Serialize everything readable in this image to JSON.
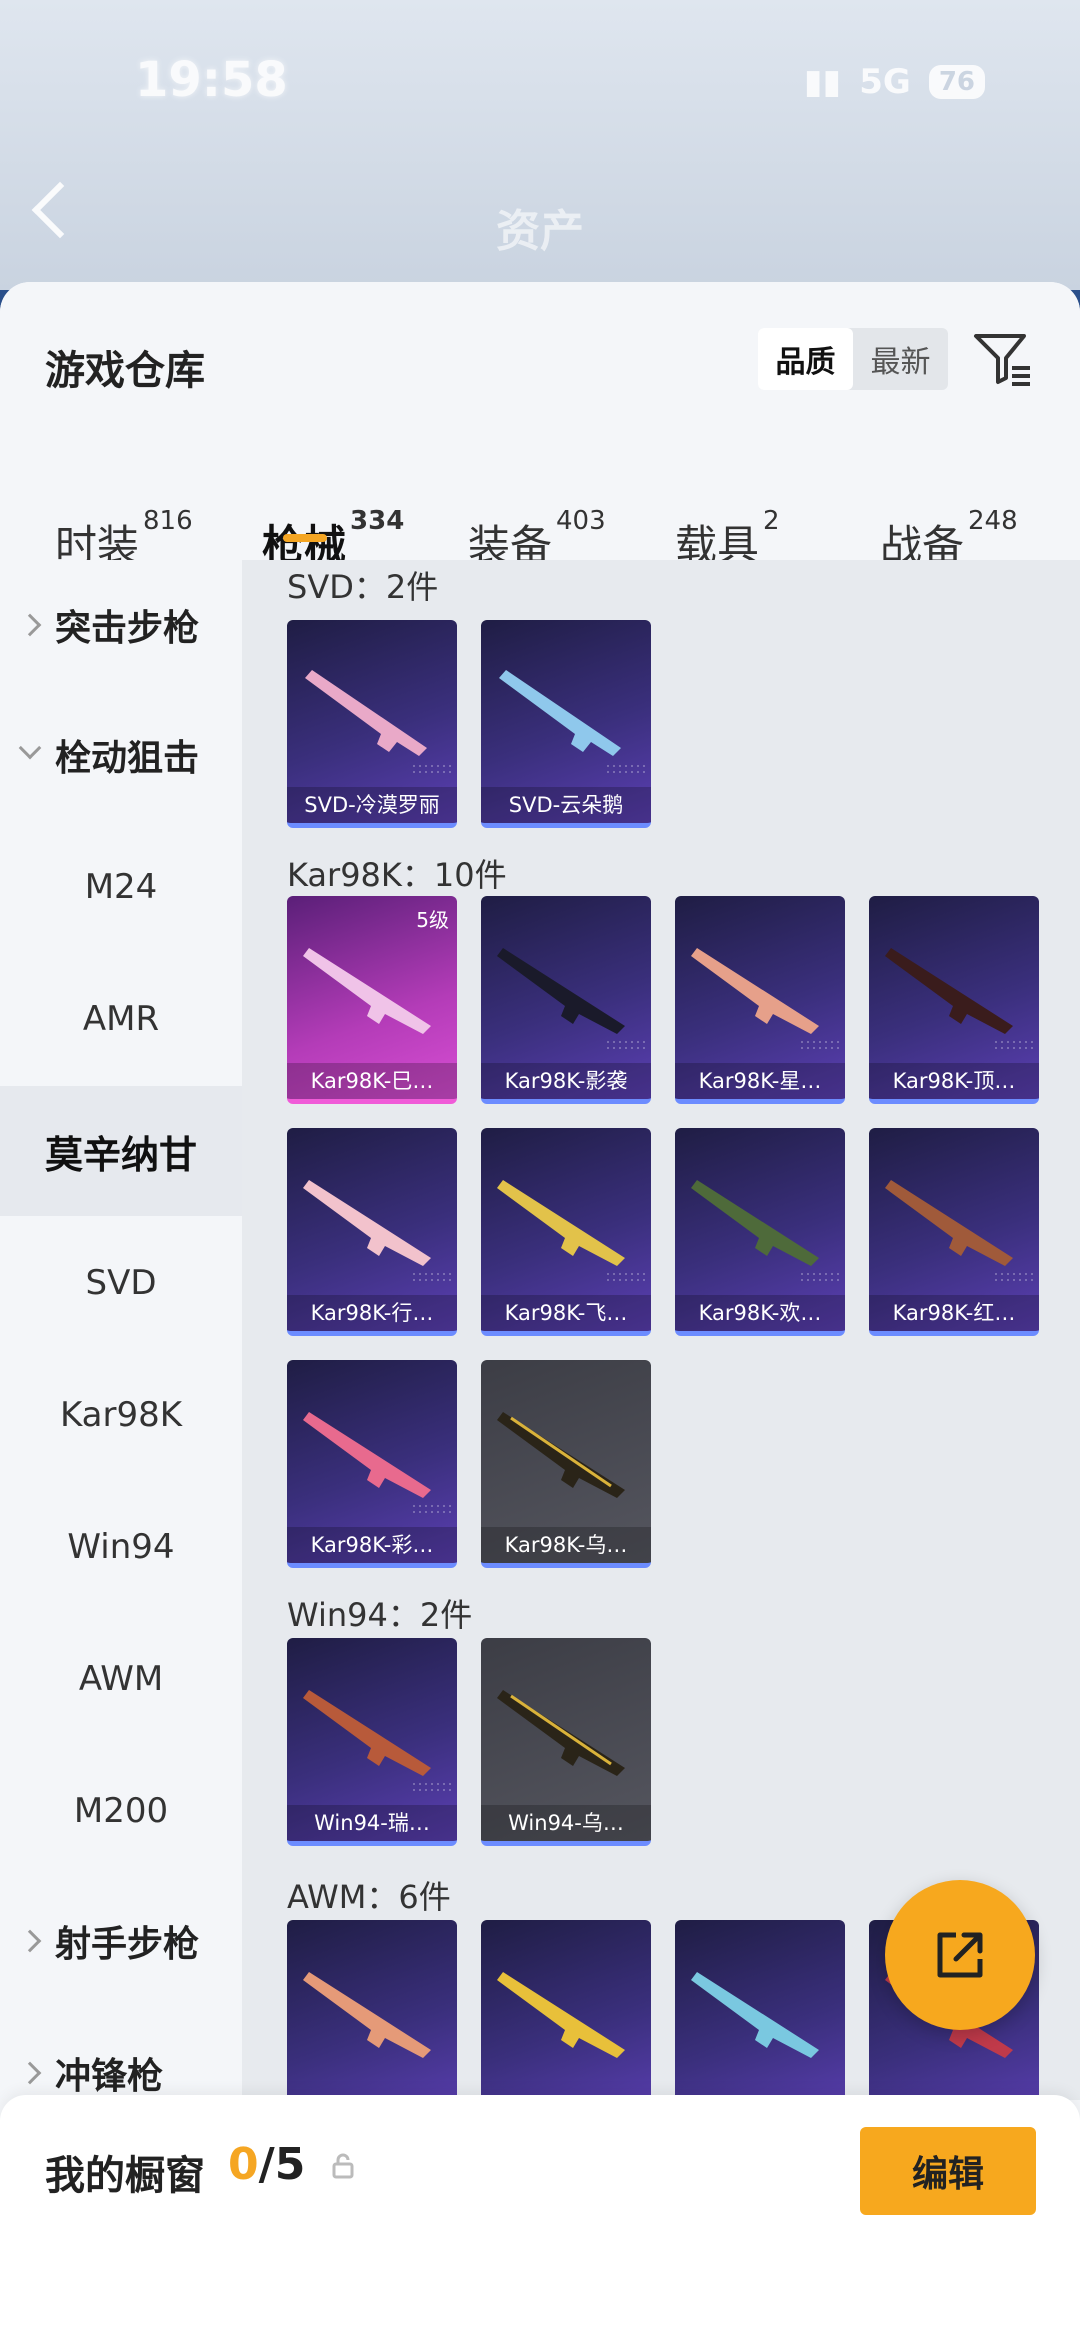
{
  "status": {
    "time": "19:58",
    "network": "5G",
    "battery": "76"
  },
  "nav": {
    "title": "资产"
  },
  "header": {
    "title": "游戏仓库",
    "sort_options": [
      "品质",
      "最新"
    ],
    "active_sort": "品质"
  },
  "categories": [
    {
      "label": "时装",
      "count": "816"
    },
    {
      "label": "枪械",
      "count": "334"
    },
    {
      "label": "装备",
      "count": "403"
    },
    {
      "label": "载具",
      "count": "2"
    },
    {
      "label": "战备",
      "count": "248"
    }
  ],
  "sidebar": {
    "groups": [
      {
        "label": "突击步枪"
      },
      {
        "label": "栓动狙击"
      },
      {
        "label": "射手步枪"
      },
      {
        "label": "冲锋枪"
      }
    ],
    "items": [
      "M24",
      "AMR",
      "莫辛纳甘",
      "SVD",
      "Kar98K",
      "Win94",
      "AWM",
      "M200"
    ],
    "selected": "莫辛纳甘"
  },
  "sections": [
    {
      "title": "SVD：2件",
      "items": [
        "SVD-冷漠罗丽",
        "SVD-云朵鹅"
      ]
    },
    {
      "title": "Kar98K：10件",
      "items": [
        "Kar98K-巳…",
        "Kar98K-影袭",
        "Kar98K-星…",
        "Kar98K-顶…",
        "Kar98K-行…",
        "Kar98K-飞…",
        "Kar98K-欢…",
        "Kar98K-红…",
        "Kar98K-彩…",
        "Kar98K-乌…"
      ],
      "first_level": "5级"
    },
    {
      "title": "Win94：2件",
      "items": [
        "Win94-瑞…",
        "Win94-乌…"
      ]
    },
    {
      "title": "AWM：6件"
    }
  ],
  "bottom": {
    "label": "我的橱窗",
    "count_current": "0",
    "count_total": "/5",
    "edit_label": "编辑"
  }
}
